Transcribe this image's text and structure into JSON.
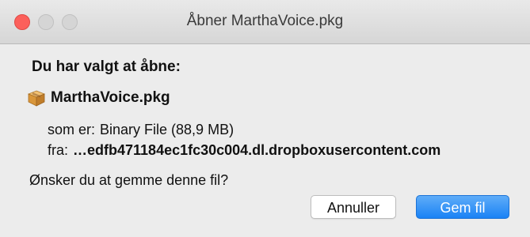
{
  "window": {
    "title": "Åbner MarthaVoice.pkg"
  },
  "dialog": {
    "heading": "Du har valgt at åbne:",
    "file_name": "MarthaVoice.pkg",
    "file_icon": "package-icon",
    "type_label": "som er:",
    "type_value": "Binary File (88,9 MB)",
    "from_label": "fra:",
    "from_value": "…edfb471184ec1fc30c004.dl.dropboxusercontent.com",
    "question": "Ønsker du at gemme denne fil?"
  },
  "buttons": {
    "cancel_label": "Annuller",
    "save_label": "Gem fil"
  },
  "colors": {
    "close_button": "#fc605b",
    "primary_button": "#1a82f5",
    "background": "#ececec"
  }
}
